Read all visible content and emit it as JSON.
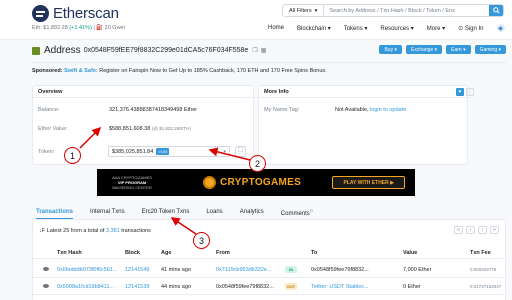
{
  "header": {
    "logo_text": "Etherscan",
    "price_prefix": "Eth: $1,892.28",
    "price_change": "(+1.41%)",
    "gas": "| ⛽ 20 Gwei",
    "search_filter": "All Filters",
    "search_placeholder": "Search by Address / Txn Hash / Block / Token / Ens",
    "nav": [
      {
        "label": "Home",
        "active": false
      },
      {
        "label": "Blockchain ▾",
        "active": false
      },
      {
        "label": "Tokens ▾",
        "active": false
      },
      {
        "label": "Resources ▾",
        "active": false
      },
      {
        "label": "More ▾",
        "active": false
      }
    ],
    "sign_in": "⊙ Sign In"
  },
  "address": {
    "title": "Address",
    "hash": "0x0548F59fEE79f8832C299e01dCA5c76F034F558e",
    "buttons": [
      "Buy ▾",
      "Exchange ▾",
      "Earn ▾",
      "Gaming ▾"
    ]
  },
  "sponsored": {
    "label": "Sponsored:",
    "brand": "Swift & Safe:",
    "text": "Register on Fairspin Now to Get Up to 185% Cashback, 170 ETH and 170 Free Spins Bonus."
  },
  "overview": {
    "title": "Overview",
    "balance_label": "Balance:",
    "balance_value": "321,376.43888387418349498 Ether",
    "ether_value_label": "Ether Value:",
    "ether_value": "$588,851,608.38",
    "ether_value_rate": "(@ $1,832.28/ETH)",
    "token_label": "Token:",
    "token_value": "$385,025,851.84",
    "token_badge": ">100"
  },
  "more_info": {
    "title": "More Info",
    "tag_label": "My Name Tag:",
    "tag_value": "Not Available,",
    "tag_link": "login to update"
  },
  "banner": {
    "line1": "AAA CRYPTOGAMES",
    "line2": "VIP PROGRAM",
    "line3": "WAGERING CENTER",
    "brand": "CRYPTOGAMES",
    "cta": "PLAY WITH ETHER ▶"
  },
  "tabs": [
    {
      "label": "Transactions",
      "active": true
    },
    {
      "label": "Internal Txns",
      "active": false
    },
    {
      "label": "Erc20 Token Txns",
      "active": false
    },
    {
      "label": "Loans",
      "active": false
    },
    {
      "label": "Analytics",
      "active": false
    },
    {
      "label": "Comments",
      "active": false
    }
  ],
  "tx": {
    "summary_prefix": "↓F Latest 25 from a total of",
    "summary_count": "3,381",
    "summary_suffix": "transactions",
    "columns": [
      "Txn Hash",
      "Block",
      "Age",
      "From",
      "To",
      "Value",
      "Txn Fee"
    ],
    "rows": [
      {
        "hash": "0x6fadddb073f0f6c561...",
        "block": "12141549",
        "age": "41 mins ago",
        "from": "0x7119cb963db332e...",
        "dir": "IN",
        "to": "0x0548f59fee79f8832...",
        "value": "7,000 Ether",
        "fee": "0.000402775"
      },
      {
        "hash": "0x5908a1fcd19b8411...",
        "block": "12141539",
        "age": "44 mins ago",
        "from": "0x0548f59fee79f8832...",
        "dir": "OUT",
        "to": "Tether: USDT Stablec...",
        "value": "0 Ether",
        "fee": "0.01727162047"
      }
    ]
  },
  "annotations": [
    "1",
    "2",
    "3"
  ],
  "colors": {
    "accent": "#3498db",
    "annotation": "#dd0000"
  }
}
